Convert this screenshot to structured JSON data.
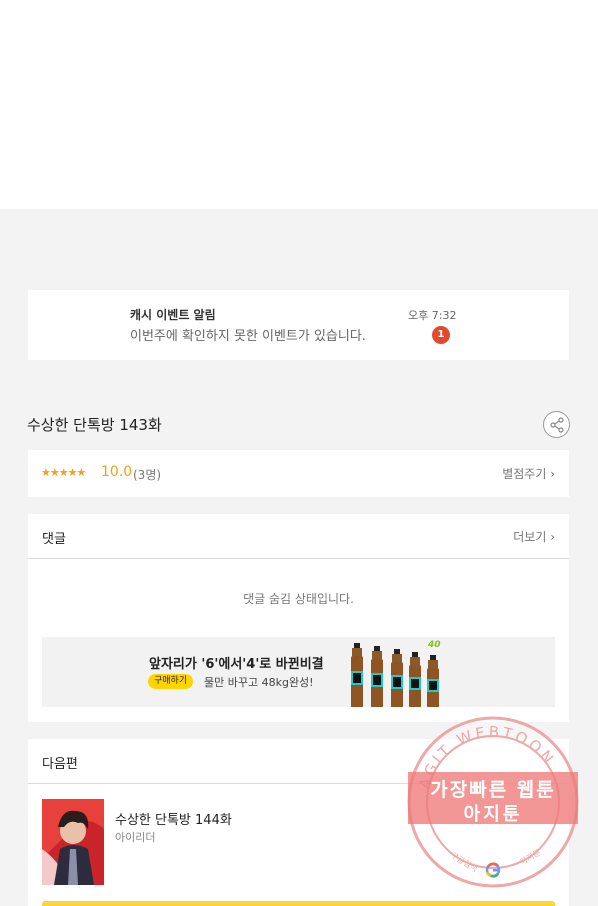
{
  "notification": {
    "title": "캐시 이벤트 알림",
    "body": "이번주에 확인하지 못한 이벤트가 있습니다.",
    "time": "오후 7:32",
    "badge": "1"
  },
  "episode": {
    "title": "수상한 단톡방 143화",
    "share_icon": "share-icon"
  },
  "rating": {
    "stars": "★★★★★",
    "score": "10.0",
    "count": "(3명)",
    "rate_link": "별점주기 ›"
  },
  "comments": {
    "title": "댓글",
    "more_link": "더보기 ›",
    "hidden_message": "댓글 숨김 상태입니다."
  },
  "ad": {
    "headline": "앞자리가 '6'에서'4'로 바뀐비결",
    "buy_label": "구매하기",
    "subtext": "물만 바꾸고 48kg완성!",
    "promo_badge": "40"
  },
  "next_episode": {
    "section_title": "다음편",
    "title": "수상한 단톡방 144화",
    "author": "아이리더"
  },
  "watermark": {
    "arc_text": "AGIT WEBTOON",
    "line1": "가장빠른 웹툰",
    "line2": "아지툰",
    "footer_left": "구글검색",
    "footer_right": "아지툰"
  },
  "colors": {
    "accent_star": "#f2a01a",
    "badge_red": "#e24a2e",
    "buy_yellow": "#ffd400",
    "watermark_pink": "#ee7878"
  }
}
